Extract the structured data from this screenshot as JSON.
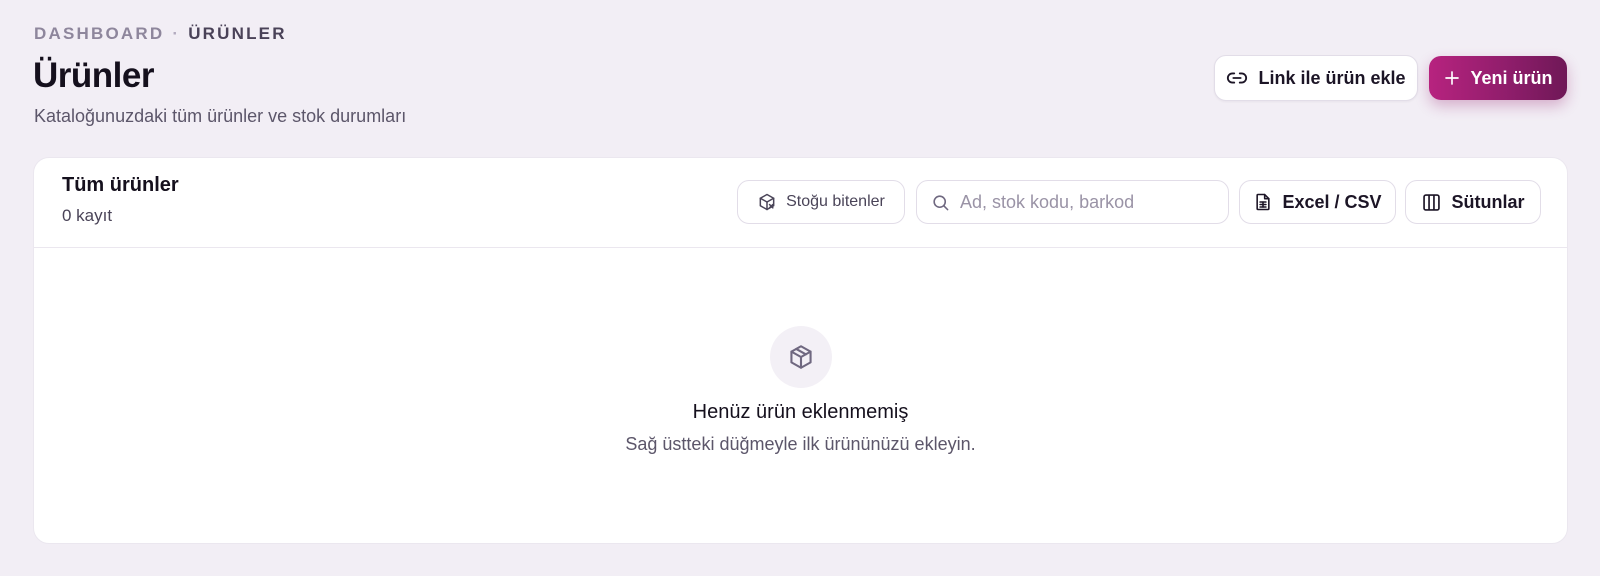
{
  "breadcrumb": {
    "items": [
      "DASHBOARD",
      "ÜRÜNLER"
    ],
    "separator": "·"
  },
  "header": {
    "title": "Ürünler",
    "subtitle": "Kataloğunuzdaki tüm ürünler ve stok durumları",
    "link_button": {
      "label": "Link ile ürün ekle",
      "icon": "link-icon"
    },
    "new_button": {
      "label": "Yeni ürün",
      "icon": "plus-icon"
    }
  },
  "card": {
    "title": "Tüm ürünler",
    "count": "0 kayıt",
    "toolbar": {
      "stock_filter": {
        "label": "Stoğu bitenler",
        "icon": "box-x-icon"
      },
      "search": {
        "placeholder": "Ad, stok kodu, barkod",
        "value": "",
        "icon": "search-icon"
      },
      "export": {
        "label": "Excel / CSV",
        "icon": "spreadsheet-file-icon"
      },
      "columns": {
        "label": "Sütunlar",
        "icon": "columns-icon"
      }
    },
    "empty_state": {
      "icon": "package-icon",
      "title": "Henüz ürün eklenmemiş",
      "description": "Sağ üstteki düğmeyle ilk ürününüzü ekleyin."
    }
  },
  "colors": {
    "background": "#f2eef5",
    "accent_start": "#b7237f",
    "accent_end": "#6f1857",
    "text_primary": "#15101d",
    "text_muted": "#5c566a"
  }
}
